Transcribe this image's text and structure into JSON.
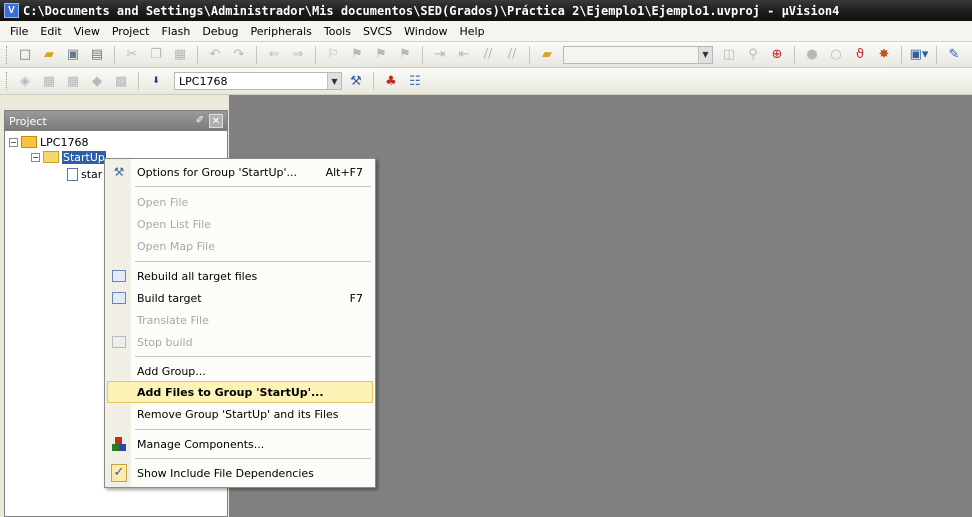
{
  "window": {
    "title": "C:\\Documents and Settings\\Administrador\\Mis documentos\\SED(Grados)\\Práctica 2\\Ejemplo1\\Ejemplo1.uvproj - µVision4",
    "app_icon_letter": "V"
  },
  "menubar": [
    "File",
    "Edit",
    "View",
    "Project",
    "Flash",
    "Debug",
    "Peripherals",
    "Tools",
    "SVCS",
    "Window",
    "Help"
  ],
  "toolbar2": {
    "target_select": "LPC1768"
  },
  "project_panel": {
    "title": "Project",
    "tree": {
      "target": "LPC1768",
      "group": "StartUp",
      "file": "star"
    }
  },
  "context_menu": {
    "items": [
      {
        "label": "Options for Group 'StartUp'...",
        "shortcut": "Alt+F7",
        "enabled": true,
        "icon": "magic-wand-icon"
      },
      {
        "label": "Open File",
        "enabled": false
      },
      {
        "label": "Open List File",
        "enabled": false
      },
      {
        "label": "Open Map File",
        "enabled": false
      },
      {
        "label": "Rebuild all target files",
        "enabled": true,
        "icon": "rebuild-icon"
      },
      {
        "label": "Build target",
        "shortcut": "F7",
        "enabled": true,
        "icon": "build-icon"
      },
      {
        "label": "Translate File",
        "enabled": false
      },
      {
        "label": "Stop build",
        "enabled": false,
        "icon": "stop-build-icon"
      },
      {
        "label": "Add Group...",
        "enabled": true
      },
      {
        "label": "Add Files to Group 'StartUp'...",
        "enabled": true,
        "highlighted": true
      },
      {
        "label": "Remove Group 'StartUp' and its Files",
        "enabled": true
      },
      {
        "label": "Manage Components...",
        "enabled": true,
        "icon": "components-icon"
      },
      {
        "label": "Show Include File Dependencies",
        "enabled": true,
        "checked": true
      }
    ]
  },
  "colors": {
    "workspace_bg": "#808080",
    "menu_highlight": "#fef3b6",
    "tree_selection": "#2d5fa8"
  }
}
